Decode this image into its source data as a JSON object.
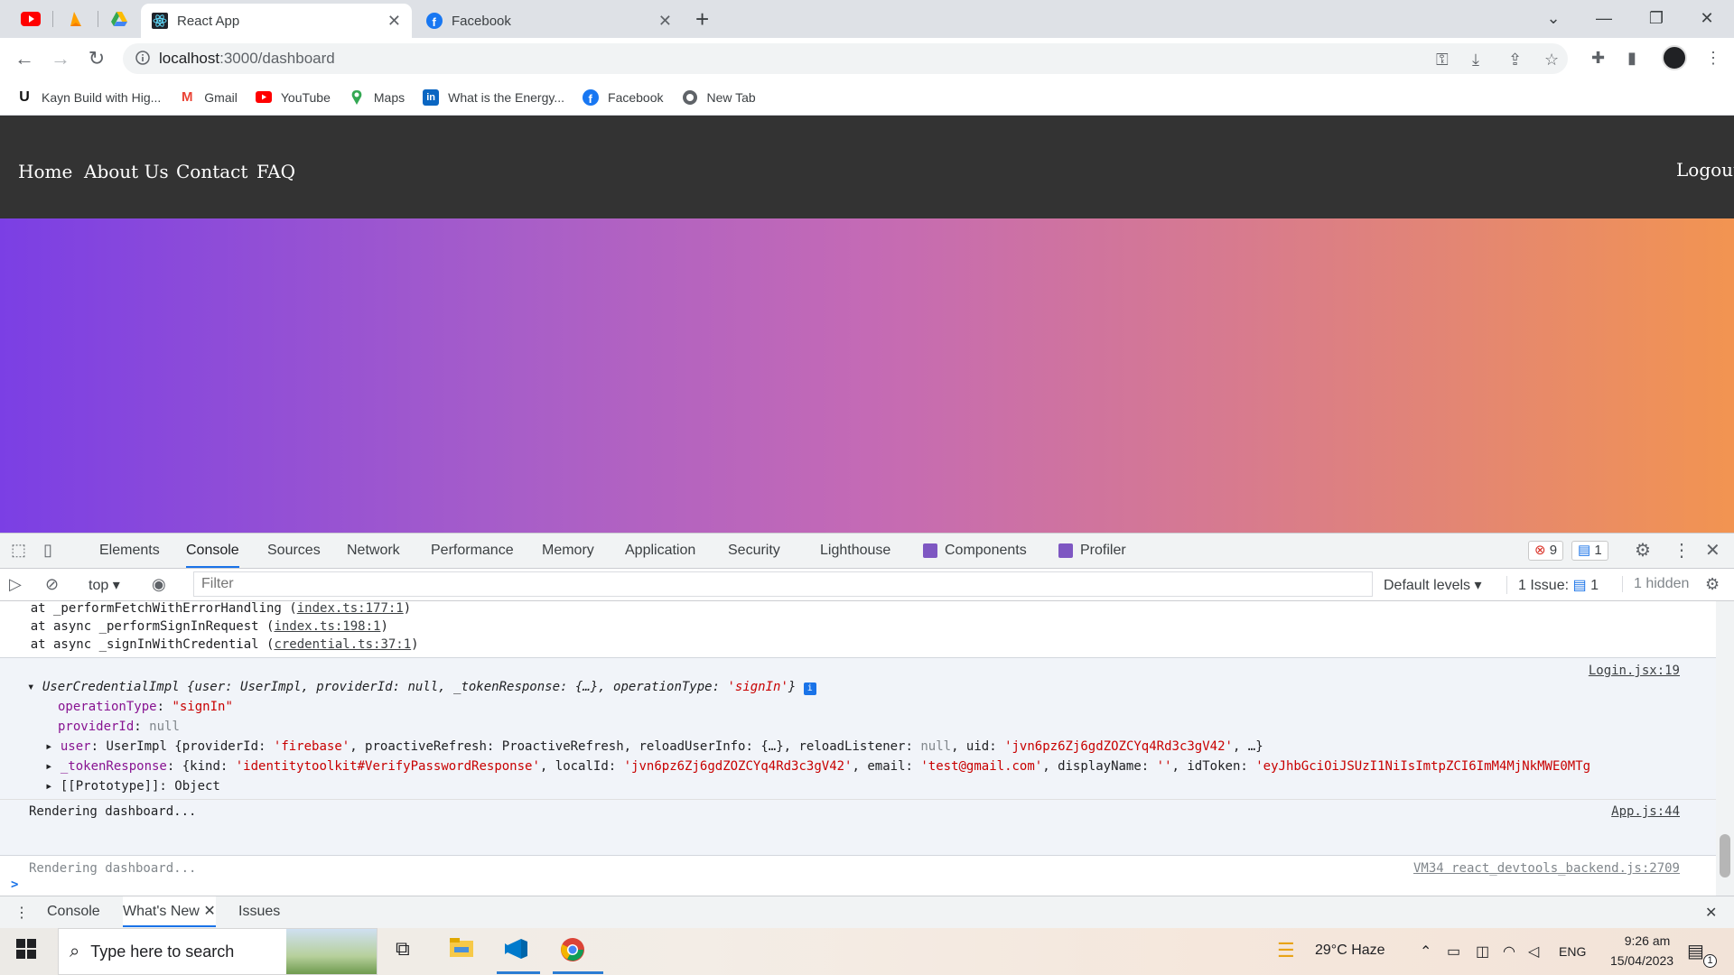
{
  "browser": {
    "tabs": [
      {
        "title": "React App",
        "active": true
      },
      {
        "title": "Facebook",
        "active": false
      }
    ],
    "url_host": "localhost",
    "url_rest": ":3000/dashboard",
    "bookmarks": [
      {
        "label": "Kayn Build with Hig...",
        "icon": "u-logo"
      },
      {
        "label": "Gmail",
        "icon": "gmail-icon"
      },
      {
        "label": "YouTube",
        "icon": "youtube-icon"
      },
      {
        "label": "Maps",
        "icon": "maps-icon"
      },
      {
        "label": "What is the Energy...",
        "icon": "linkedin-icon"
      },
      {
        "label": "Facebook",
        "icon": "facebook-icon"
      },
      {
        "label": "New Tab",
        "icon": "globe-icon"
      }
    ]
  },
  "site": {
    "nav": [
      "Home",
      "About Us",
      "Contact",
      "FAQ"
    ],
    "logout": "Logout"
  },
  "devtools": {
    "tabs": [
      "Elements",
      "Console",
      "Sources",
      "Network",
      "Performance",
      "Memory",
      "Application",
      "Security",
      "Lighthouse",
      "Components",
      "Profiler"
    ],
    "active_tab": "Console",
    "error_count": "9",
    "message_count": "1",
    "context": "top",
    "filter_placeholder": "Filter",
    "levels": "Default levels",
    "issues_label": "1 Issue:",
    "issues_count": "1",
    "hidden": "1 hidden",
    "stack": [
      {
        "prefix": "    at _performFetchWithErrorHandling (",
        "link": "index.ts:177:1",
        "suffix": ")"
      },
      {
        "prefix": "    at async _performSignInRequest (",
        "link": "index.ts:198:1",
        "suffix": ")"
      },
      {
        "prefix": "    at async _signInWithCredential (",
        "link": "credential.ts:37:1",
        "suffix": ")"
      }
    ],
    "obj": {
      "source": "Login.jsx:19",
      "summary_name": "UserCredentialImpl ",
      "summary": "{user: UserImpl, providerId: null, _tokenResponse: {…}, operationType: ",
      "summary_str": "'signIn'",
      "summary_end": "}",
      "op_key": "operationType",
      "op_val": "\"signIn\"",
      "pid_key": "providerId",
      "pid_val": "null",
      "user_key": "user",
      "user_line_a": " UserImpl {providerId: ",
      "user_str1": "'firebase'",
      "user_line_b": ", proactiveRefresh: ProactiveRefresh, reloadUserInfo: {…}, reloadListener: ",
      "user_null": "null",
      "user_line_c": ", uid: ",
      "user_uid": "'jvn6pz6Zj6gdZOZCYq4Rd3c3gV42'",
      "user_line_d": ", …}",
      "tok_key": "_tokenResponse",
      "tok_line_a": " {kind: ",
      "tok_kind": "'identitytoolkit#VerifyPasswordResponse'",
      "tok_line_b": ", localId: ",
      "tok_local": "'jvn6pz6Zj6gdZOZCYq4Rd3c3gV42'",
      "tok_line_c": ", email: ",
      "tok_email": "'test@gmail.com'",
      "tok_line_d": ", displayName: ",
      "tok_dn": "''",
      "tok_line_e": ", idToken: ",
      "tok_id": "'eyJhbGciOiJSUzI1NiIsImtpZCI6ImM4MjNkMWE0MTg",
      "proto": "[[Prototype]]: Object"
    },
    "logs": [
      {
        "text": "Rendering dashboard...",
        "source": "App.js:44"
      },
      {
        "text": "Rendering dashboard...",
        "source": "VM34 react_devtools_backend.js:2709"
      }
    ],
    "prompt": ">",
    "drawer_tabs": [
      "Console",
      "What's New",
      "Issues"
    ]
  },
  "taskbar": {
    "search_placeholder": "Type here to search",
    "weather": "29°C  Haze",
    "lang": "ENG",
    "time": "9:26 am",
    "date": "15/04/2023",
    "notif_count": "1"
  }
}
